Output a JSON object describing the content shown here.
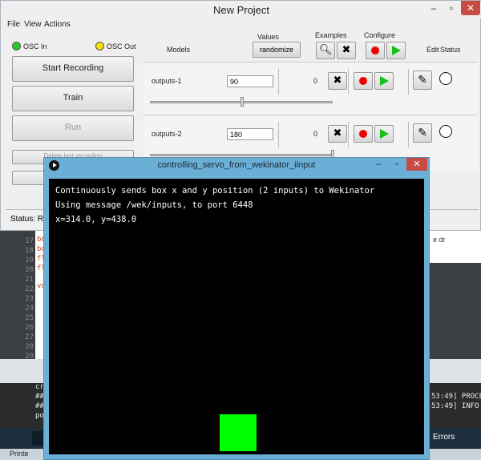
{
  "wekinator": {
    "title": "New Project",
    "window_controls": {
      "minimize": "–",
      "maximize": "▫",
      "close": "✕"
    },
    "menu": [
      "File",
      "View",
      "Actions"
    ],
    "osc_in_label": "OSC In",
    "osc_out_label": "OSC Out",
    "buttons": {
      "start_recording": "Start Recording",
      "train": "Train",
      "run": "Run",
      "delete_last": "Delete last recording",
      "reset": "Re"
    },
    "status_label": "Status: Rea",
    "headers": {
      "models": "Models",
      "values": "Values",
      "examples": "Examples",
      "configure": "Configure",
      "edit": "Edit",
      "status": "Status"
    },
    "randomize_label": "randomize",
    "outputs": [
      {
        "name": "outputs-1",
        "value": "90",
        "examples": "0",
        "slider_fraction": 0.5
      },
      {
        "name": "outputs-2",
        "value": "180",
        "examples": "0",
        "slider_fraction": 1.0
      }
    ],
    "colors": {
      "osc_in": "#22cc22",
      "osc_out": "#f0e000",
      "record": "#e00000",
      "run": "#18c118"
    }
  },
  "sketch": {
    "title": "controlling_servo_from_wekinator_iinput",
    "lines": [
      "Continuously sends box x and y position (2 inputs) to Wekinator",
      "Using message /wek/inputs, to port 6448",
      "x=314.0, y=438.0"
    ],
    "box_color": "#00ff00"
  },
  "editor": {
    "line_numbers": [
      "17",
      "18",
      "19",
      "20",
      "21",
      "22",
      "23",
      "24",
      "25",
      "26",
      "27",
      "28",
      "29"
    ],
    "code_fragments": [
      "bo",
      "bo",
      "fl",
      "fl",
      "vo"
    ],
    "right_fragment": "e dr"
  },
  "console": {
    "lines": [
      "cr",
      "##",
      "##",
      "po"
    ],
    "right_lines": [
      "0",
      "53:49] PROCE",
      "53:49] INFO"
    ],
    "errors_tab": "Errors"
  },
  "taskbar": {
    "label": "Printe"
  }
}
